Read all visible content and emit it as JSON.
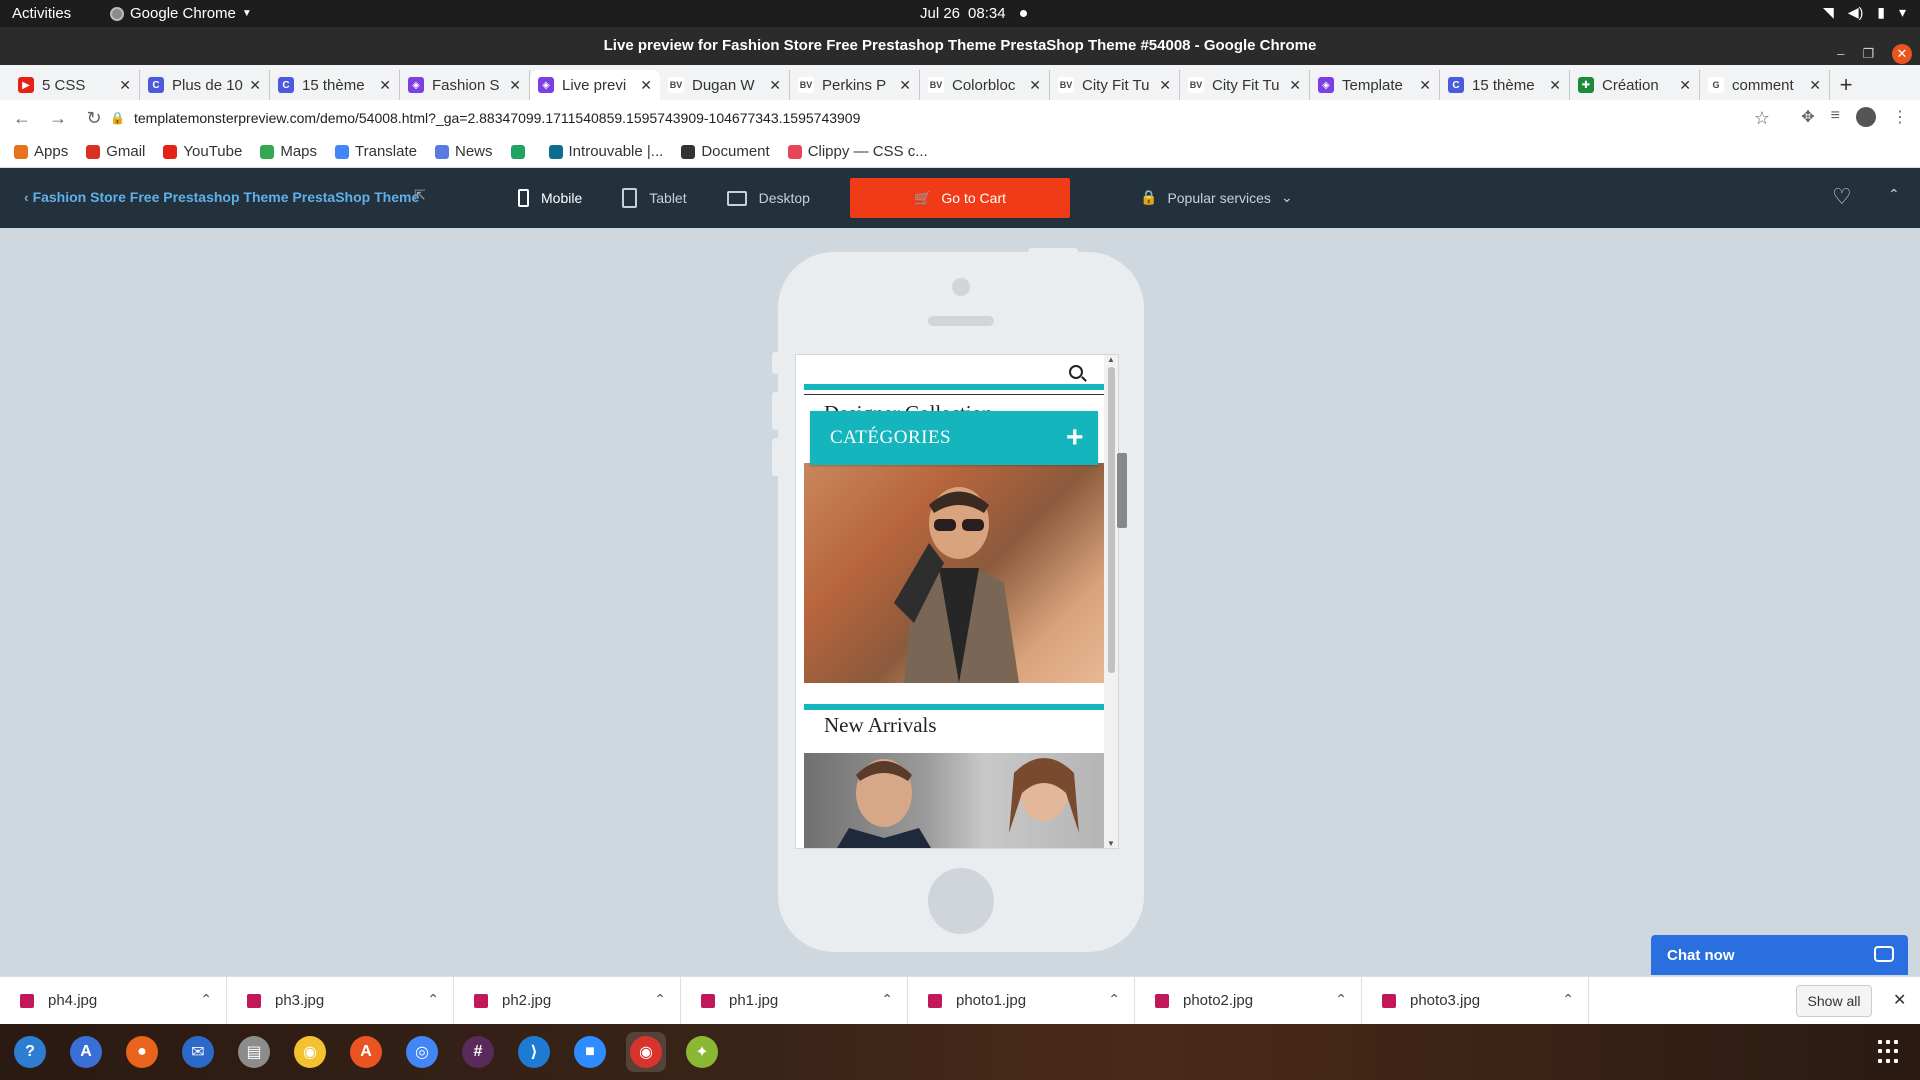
{
  "gnome": {
    "activities": "Activities",
    "app_name": "Google Chrome",
    "date": "Jul 26",
    "time": "08:34"
  },
  "window": {
    "title": "Live preview for Fashion Store Free Prestashop Theme PrestaShop Theme #54008 - Google Chrome"
  },
  "tabs": [
    {
      "label": "5 CSS",
      "favicon": "youtube-icon",
      "color": "#e62117",
      "fav_text": "▶"
    },
    {
      "label": "Plus de 10",
      "favicon": "c-icon",
      "color": "#4b5bdc",
      "fav_text": "C"
    },
    {
      "label": "15 thème",
      "favicon": "c-icon",
      "color": "#4b5bdc",
      "fav_text": "C"
    },
    {
      "label": "Fashion S",
      "favicon": "tm-icon",
      "color": "#7b3fe4",
      "fav_text": "◈"
    },
    {
      "label": "Live previ",
      "favicon": "tm-icon",
      "color": "#7b3fe4",
      "fav_text": "◈"
    },
    {
      "label": "Dugan W",
      "favicon": "bv-icon",
      "color": "#ffffff",
      "fav_text": "BV"
    },
    {
      "label": "Perkins P",
      "favicon": "bv-icon",
      "color": "#ffffff",
      "fav_text": "BV"
    },
    {
      "label": "Colorbloc",
      "favicon": "bv-icon",
      "color": "#ffffff",
      "fav_text": "BV"
    },
    {
      "label": "City Fit Tu",
      "favicon": "bv-icon",
      "color": "#ffffff",
      "fav_text": "BV"
    },
    {
      "label": "City Fit Tu",
      "favicon": "bv-icon",
      "color": "#ffffff",
      "fav_text": "BV"
    },
    {
      "label": "Template",
      "favicon": "tm-icon",
      "color": "#7b3fe4",
      "fav_text": "◈"
    },
    {
      "label": "15 thème",
      "favicon": "c-icon",
      "color": "#4b5bdc",
      "fav_text": "C"
    },
    {
      "label": "Création",
      "favicon": "green-icon",
      "color": "#1c8c3c",
      "fav_text": "✚"
    },
    {
      "label": "comment",
      "favicon": "google-icon",
      "color": "#ffffff",
      "fav_text": "G"
    }
  ],
  "url": "templatemonsterpreview.com/demo/54008.html?_ga=2.88347099.1711540859.1595743909-104677343.1595743909",
  "bookmarks": [
    {
      "label": "Apps",
      "icon": "apps-grid-icon",
      "color": "#e8711c"
    },
    {
      "label": "Gmail",
      "icon": "gmail-icon",
      "color": "#d93025"
    },
    {
      "label": "YouTube",
      "icon": "youtube-icon",
      "color": "#e62117"
    },
    {
      "label": "Maps",
      "icon": "maps-icon",
      "color": "#34a853"
    },
    {
      "label": "Translate",
      "icon": "translate-icon",
      "color": "#4285f4"
    },
    {
      "label": "News",
      "icon": "news-icon",
      "color": "#5b7be0"
    },
    {
      "label": "",
      "icon": "drive-icon",
      "color": "#1fa463"
    },
    {
      "label": "Introuvable |...",
      "icon": "page-icon",
      "color": "#0b6e8e"
    },
    {
      "label": "Document",
      "icon": "github-icon",
      "color": "#333333"
    },
    {
      "label": "Clippy — CSS c...",
      "icon": "clippy-icon",
      "color": "#e8455b"
    }
  ],
  "tm_bar": {
    "back_title": "Fashion Store Free Prestashop Theme PrestaShop Theme",
    "devices": [
      "Mobile",
      "Tablet",
      "Desktop"
    ],
    "cart_label": "Go to Cart",
    "popular_label": "Popular services"
  },
  "site": {
    "designer_title": "Designer Collection",
    "categories_label": "CATÉGORIES",
    "new_arrivals_title": "New Arrivals",
    "accent_color": "#15b5bd"
  },
  "chat": {
    "label": "Chat now"
  },
  "downloads": {
    "files": [
      "ph4.jpg",
      "ph3.jpg",
      "ph2.jpg",
      "ph1.jpg",
      "photo1.jpg",
      "photo2.jpg",
      "photo3.jpg"
    ],
    "show_all": "Show all"
  },
  "dock": {
    "apps": [
      {
        "name": "help-icon",
        "glyph": "?",
        "color": "#2d7dd2"
      },
      {
        "name": "translate-icon",
        "glyph": "A",
        "color": "#3a6fd8"
      },
      {
        "name": "firefox-icon",
        "glyph": "●",
        "color": "#e8631c"
      },
      {
        "name": "thunderbird-icon",
        "glyph": "✉",
        "color": "#2c69c9"
      },
      {
        "name": "files-icon",
        "glyph": "▤",
        "color": "#8c8c8c"
      },
      {
        "name": "rhythmbox-icon",
        "glyph": "◉",
        "color": "#f2c230"
      },
      {
        "name": "software-icon",
        "glyph": "A",
        "color": "#e95420"
      },
      {
        "name": "chromium-icon",
        "glyph": "◎",
        "color": "#4285f4"
      },
      {
        "name": "slack-icon",
        "glyph": "#",
        "color": "#5a2a5a"
      },
      {
        "name": "vscode-icon",
        "glyph": "⟩",
        "color": "#1e7bd3"
      },
      {
        "name": "zoom-icon",
        "glyph": "■",
        "color": "#2d8cff"
      },
      {
        "name": "chrome-icon",
        "glyph": "◉",
        "color": "#d8342c"
      },
      {
        "name": "network-icon",
        "glyph": "✦",
        "color": "#8ab832"
      }
    ]
  }
}
